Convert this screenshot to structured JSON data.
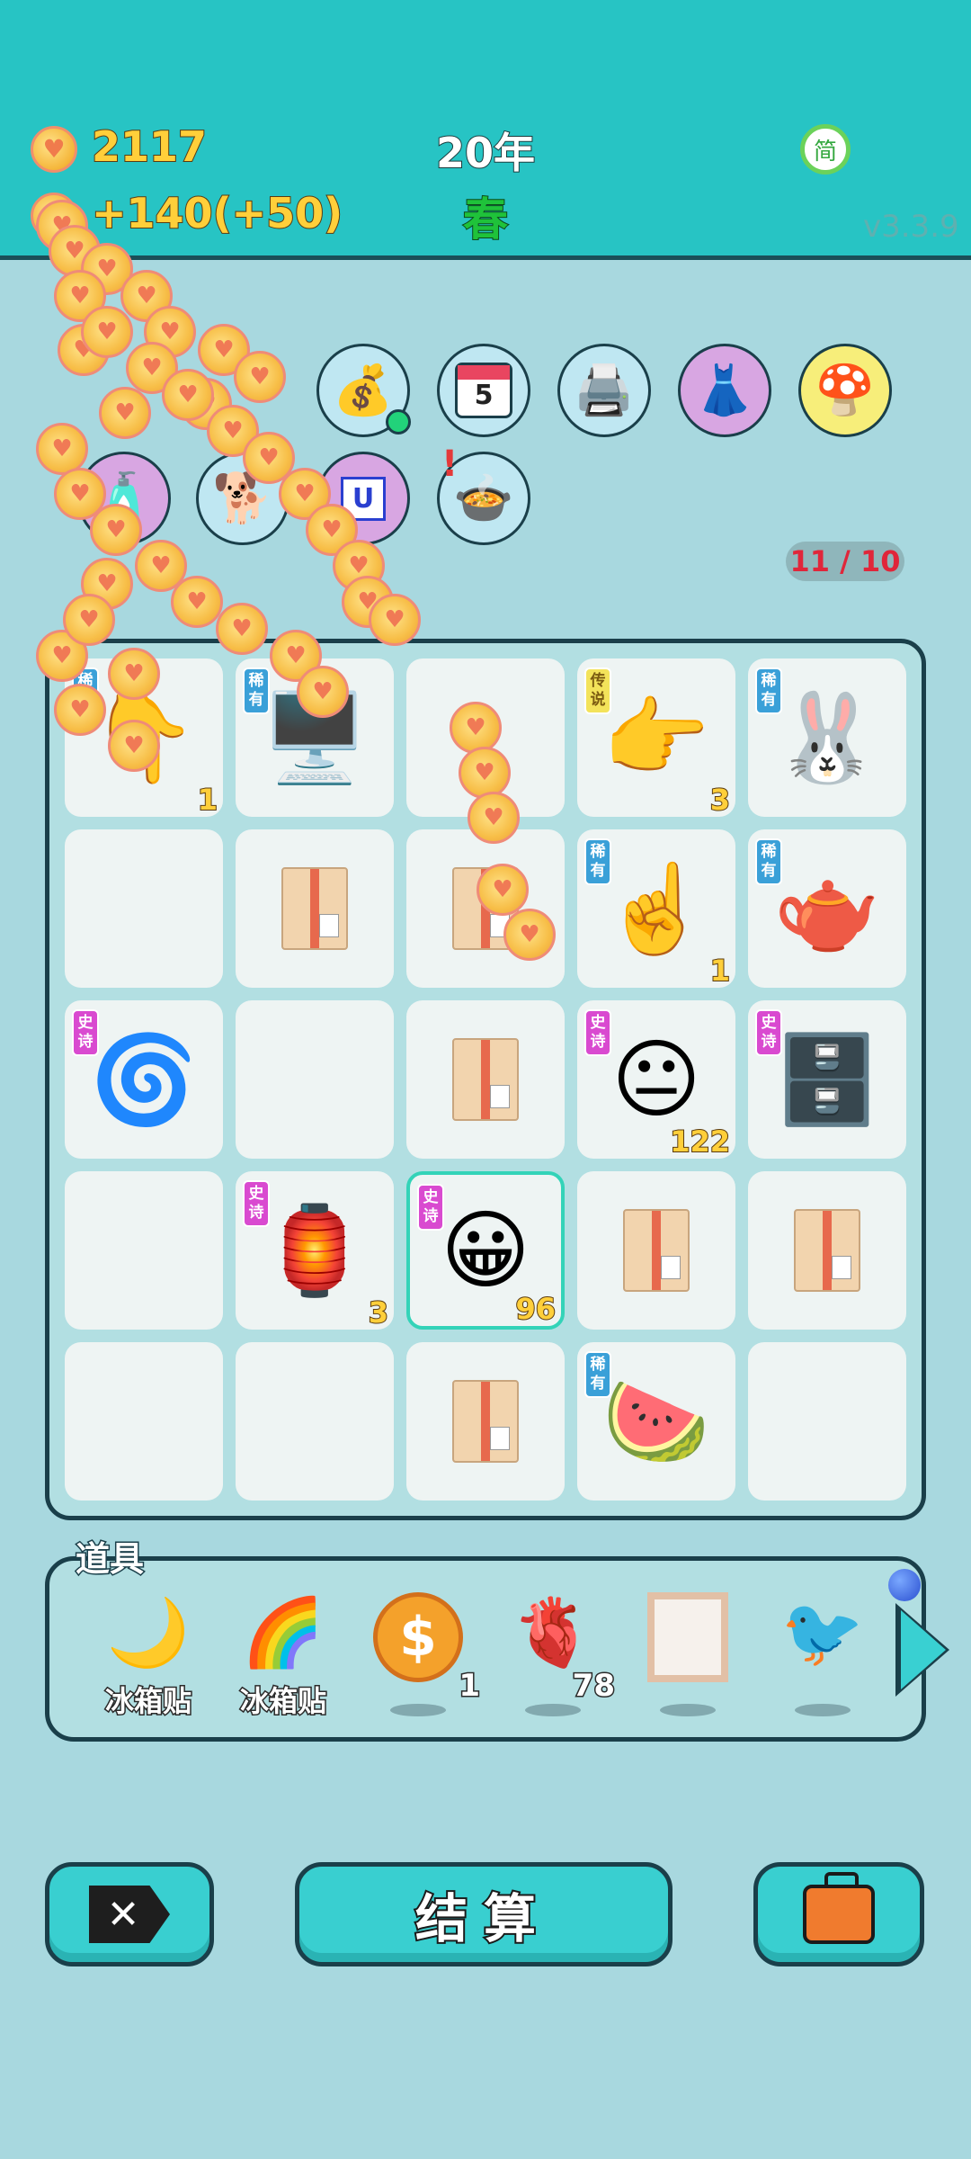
{
  "header": {
    "coins": "2117",
    "income": "+140",
    "income_bonus": "(+50)",
    "year": "20年",
    "season": "春",
    "lang_button": "简",
    "version": "v3.3.9"
  },
  "equipment": [
    {
      "name": "money-bag",
      "icon": "💰"
    },
    {
      "name": "calendar",
      "icon": "📅",
      "label": "5"
    },
    {
      "name": "printer",
      "icon": "🖨️"
    },
    {
      "name": "skirt",
      "icon": "👗"
    },
    {
      "name": "mushroom-cloud",
      "icon": "🍄"
    },
    {
      "name": "spray-bottle",
      "icon": "🧴"
    },
    {
      "name": "dog",
      "icon": "🐕"
    },
    {
      "name": "badge-u",
      "icon": "U"
    },
    {
      "name": "pot",
      "icon": "🍲"
    }
  ],
  "counter": "11 / 10",
  "grid": {
    "cells": [
      {
        "icon": "👇",
        "badge": "稀有",
        "rarity": "rare",
        "count": "1"
      },
      {
        "icon": "🖥️",
        "badge": "稀有",
        "rarity": "rare",
        "count": ""
      },
      {
        "icon": "",
        "badge": "",
        "rarity": "",
        "count": ""
      },
      {
        "icon": "👉",
        "badge": "传说",
        "rarity": "legend",
        "count": "3"
      },
      {
        "icon": "🐰",
        "badge": "稀有",
        "rarity": "rare",
        "count": ""
      },
      {
        "icon": "",
        "badge": "",
        "rarity": "",
        "count": ""
      },
      {
        "icon": "box",
        "badge": "",
        "rarity": "",
        "count": ""
      },
      {
        "icon": "box",
        "badge": "",
        "rarity": "",
        "count": ""
      },
      {
        "icon": "☝️",
        "badge": "稀有",
        "rarity": "rare",
        "count": "1"
      },
      {
        "icon": "🫖",
        "badge": "稀有",
        "rarity": "rare",
        "count": ""
      },
      {
        "icon": "🌀",
        "badge": "史诗",
        "rarity": "epic",
        "count": ""
      },
      {
        "icon": "",
        "badge": "",
        "rarity": "",
        "count": ""
      },
      {
        "icon": "box",
        "badge": "",
        "rarity": "",
        "count": ""
      },
      {
        "icon": "😐",
        "badge": "史诗",
        "rarity": "epic",
        "count": "122"
      },
      {
        "icon": "🗄️",
        "badge": "史诗",
        "rarity": "epic",
        "count": ""
      },
      {
        "icon": "",
        "badge": "",
        "rarity": "",
        "count": ""
      },
      {
        "icon": "🏮",
        "badge": "史诗",
        "rarity": "epic",
        "count": "3"
      },
      {
        "icon": "😀",
        "badge": "史诗",
        "rarity": "epic",
        "count": "96",
        "selected": true
      },
      {
        "icon": "box",
        "badge": "",
        "rarity": "",
        "count": ""
      },
      {
        "icon": "box",
        "badge": "",
        "rarity": "",
        "count": ""
      },
      {
        "icon": "",
        "badge": "",
        "rarity": "",
        "count": ""
      },
      {
        "icon": "",
        "badge": "",
        "rarity": "",
        "count": ""
      },
      {
        "icon": "box",
        "badge": "",
        "rarity": "",
        "count": ""
      },
      {
        "icon": "🍉",
        "badge": "稀有",
        "rarity": "rare",
        "count": ""
      },
      {
        "icon": "",
        "badge": "",
        "rarity": "",
        "count": ""
      }
    ]
  },
  "tools": {
    "title": "道具",
    "items": [
      {
        "name": "moon-fridge-magnet",
        "icon": "🌙",
        "label": "冰箱贴",
        "count": ""
      },
      {
        "name": "rainbow-fridge-magnet",
        "icon": "🌈",
        "label": "冰箱贴",
        "count": ""
      },
      {
        "name": "dollar-coin",
        "icon": "$",
        "label": "",
        "count": "1"
      },
      {
        "name": "liver",
        "icon": "🫀",
        "label": "",
        "count": "78"
      },
      {
        "name": "frame",
        "icon": "frame",
        "label": "",
        "count": ""
      },
      {
        "name": "bird",
        "icon": "🐦",
        "label": "",
        "count": ""
      }
    ]
  },
  "buttons": {
    "close": "✕",
    "settle": "结算",
    "bag": "bag"
  },
  "colors": {
    "header_bg": "#27c4c4",
    "page_bg": "#a8d8df",
    "gold_text": "#ffcf3a",
    "season_green": "#1fc23a",
    "rare_badge": "#3aa0d8",
    "epic_badge": "#d94ad0",
    "legend_badge": "#f3e35a",
    "counter_red": "#e0263a"
  }
}
